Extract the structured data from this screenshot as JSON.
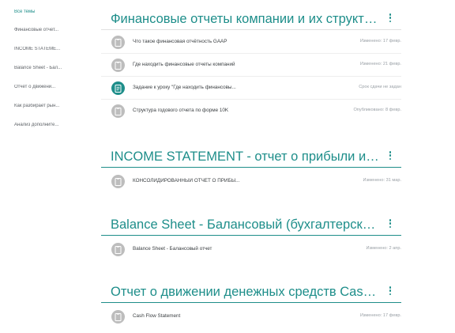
{
  "sidebar": {
    "items": [
      {
        "label": "Все темы",
        "active": true
      },
      {
        "label": "Финансовые отчет..."
      },
      {
        "label": "INCOME STATEME..."
      },
      {
        "label": "Balance Sheet - Бал..."
      },
      {
        "label": "Отчет о движени..."
      },
      {
        "label": "Как разбирает рын..."
      },
      {
        "label": "Анализ дополните..."
      }
    ]
  },
  "topics": [
    {
      "title": "Финансовые отчеты компании и их структура",
      "items": [
        {
          "title": "Что такое финансовая отчётность GAAP",
          "meta": "Изменено: 17 февр.",
          "icon": "material-icon"
        },
        {
          "title": "Где находить финансовые отчеты компаний",
          "meta": "Изменено: 21 февр.",
          "icon": "material-icon"
        },
        {
          "title": "Задание к уроку \"Где находить финансовы...",
          "meta": "Срок сдачи не задан",
          "icon": "assignment-icon"
        },
        {
          "title": "Структура годового отчета по форме 10K",
          "meta": "Опубликовано: 8 февр.",
          "icon": "material-icon"
        }
      ]
    },
    {
      "title": "INCOME STATEMENT - отчет о прибыли и уб...",
      "items": [
        {
          "title": "КОНСОЛИДИРОВАННЫЙ ОТЧЕТ О ПРИБЫ...",
          "meta": "Изменено: 31 мар.",
          "icon": "material-icon"
        }
      ]
    },
    {
      "title": "Balance Sheet - Балансовый (бухгалтерский)...",
      "items": [
        {
          "title": "Balance Sheet - Балансовый отчет",
          "meta": "Изменено: 2 апр.",
          "icon": "material-icon"
        }
      ]
    },
    {
      "title": "Отчет о движении денежных средств Cash ...",
      "items": [
        {
          "title": "Cash Flow Statement",
          "meta": "Изменено: 17 февр.",
          "icon": "material-icon"
        }
      ]
    }
  ],
  "colors": {
    "accent": "#1e8e8a",
    "icon_gray": "#bdbdbd"
  }
}
